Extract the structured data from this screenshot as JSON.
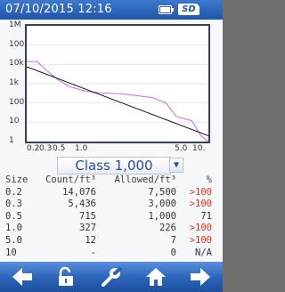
{
  "status_bar": {
    "datetime": "07/10/2015  12:16",
    "sd_label": "SD",
    "icons": [
      "battery-icon",
      "sd-card-icon"
    ]
  },
  "chart_data": {
    "type": "line",
    "x_scale": "log",
    "y_scale": "log",
    "xlim": [
      0.2,
      10.0
    ],
    "ylim": [
      1,
      1000000
    ],
    "x_tick_labels": [
      "0.2",
      "0.3",
      "0.5",
      "1.0",
      "5.0",
      "10."
    ],
    "y_tick_labels": [
      "1M",
      "100k",
      "10k",
      "1k",
      "100",
      "10",
      "1"
    ],
    "series": [
      {
        "color": "#c070d8",
        "x": [
          0.2,
          0.25,
          0.3,
          0.4,
          0.5,
          0.7,
          1.0,
          1.5,
          2.0,
          3.0,
          4.0,
          5.0,
          7.0,
          8.5,
          10.0
        ],
        "y": [
          14076,
          14076,
          5436,
          1500,
          715,
          420,
          327,
          300,
          250,
          190,
          100,
          20,
          12,
          2,
          1
        ]
      },
      {
        "color": "#111111",
        "x": [
          0.2,
          10.0
        ],
        "y": [
          7500,
          2
        ]
      }
    ]
  },
  "class_selector": {
    "value": "Class 1,000",
    "arrow": "chevron-down-icon"
  },
  "table": {
    "headers": {
      "size": "Size",
      "count": "Count/ft³",
      "allowed": "Allowed/ft³",
      "pct": "%"
    },
    "rows": [
      {
        "size": "0.2",
        "count": "14,076",
        "allowed": "7,500",
        "pct": ">100",
        "over": true
      },
      {
        "size": "0.3",
        "count": "5,436",
        "allowed": "3,000",
        "pct": ">100",
        "over": true
      },
      {
        "size": "0.5",
        "count": "715",
        "allowed": "1,000",
        "pct": "71",
        "over": false
      },
      {
        "size": "1.0",
        "count": "327",
        "allowed": "226",
        "pct": ">100",
        "over": true
      },
      {
        "size": "5.0",
        "count": "12",
        "allowed": "7",
        "pct": ">100",
        "over": true
      },
      {
        "size": "10",
        "count": "-",
        "allowed": "0",
        "pct": "N/A",
        "over": false
      }
    ],
    "over_color": "#d43b2f"
  },
  "nav": {
    "icons": [
      "left-arrow-icon",
      "unlock-icon",
      "wrench-icon",
      "home-icon",
      "right-arrow-icon"
    ]
  }
}
